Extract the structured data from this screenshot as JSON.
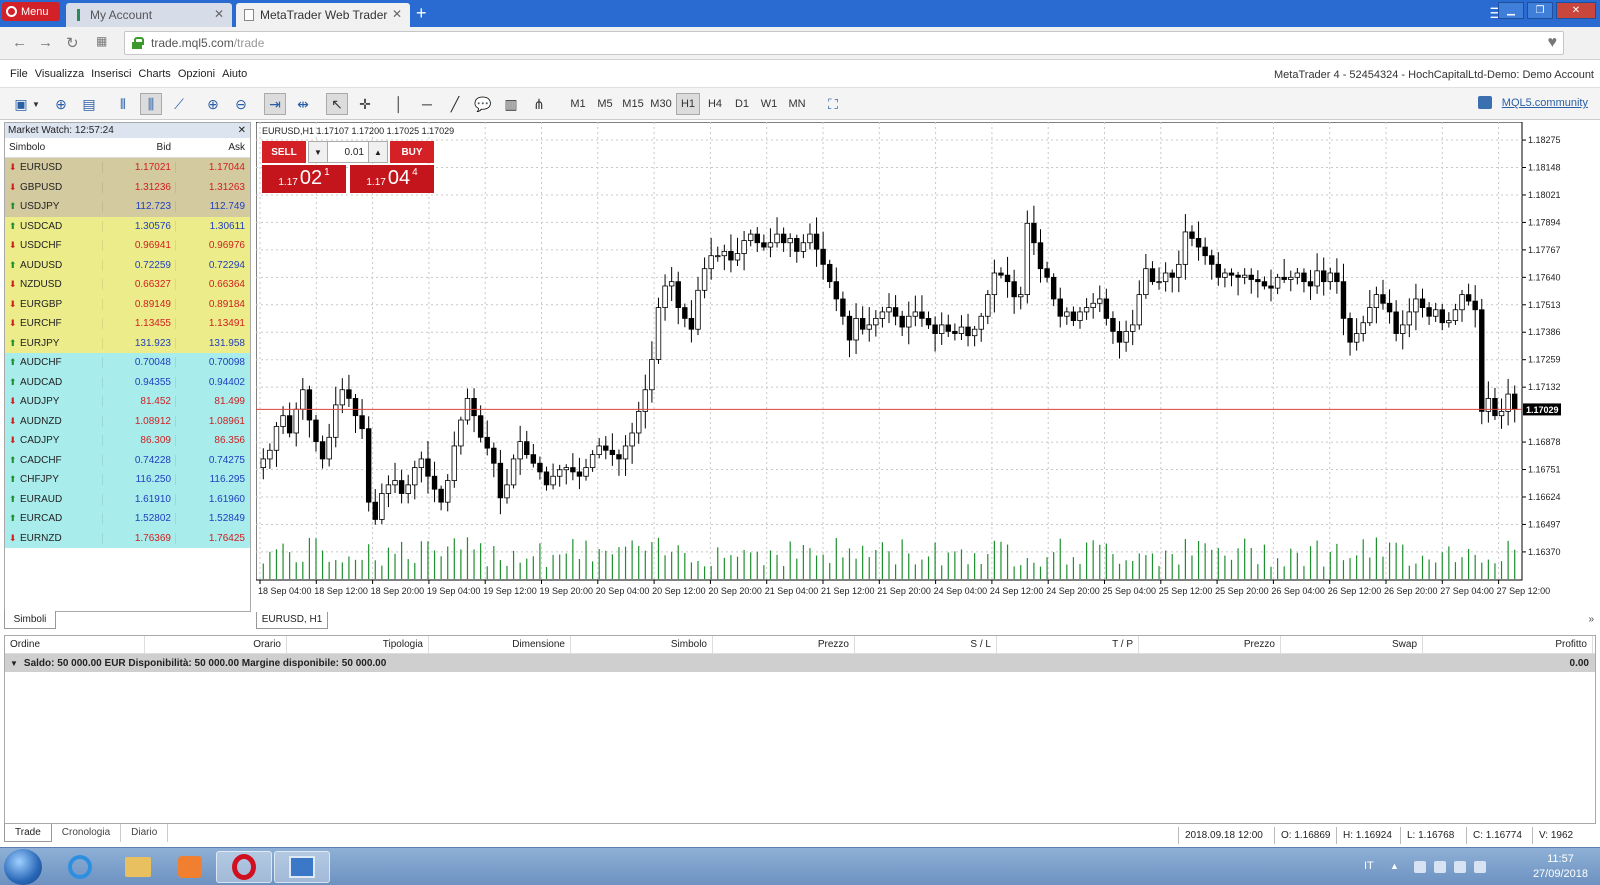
{
  "browser": {
    "menu_label": "Menu",
    "tabs": [
      {
        "title": "My Account",
        "active": false
      },
      {
        "title": "MetaTrader Web Trader",
        "active": true
      }
    ],
    "url_domain": "trade.mql5.com",
    "url_path": "/trade"
  },
  "app_menu": [
    "File",
    "Visualizza",
    "Inserisci",
    "Charts",
    "Opzioni",
    "Aiuto"
  ],
  "account_label": "MetaTrader 4 - 52454324 - HochCapitalLtd-Demo: Demo Account",
  "toolbar": {
    "timeframes": [
      "M1",
      "M5",
      "M15",
      "M30",
      "H1",
      "H4",
      "D1",
      "W1",
      "MN"
    ],
    "selected_timeframe": "H1",
    "community_link": "MQL5.community"
  },
  "market_watch": {
    "title": "Market Watch: 12:57:24",
    "headers": {
      "symbol": "Simbolo",
      "bid": "Bid",
      "ask": "Ask"
    },
    "rows": [
      {
        "symbol": "EURUSD",
        "bid": "1.17021",
        "ask": "1.17044",
        "dir": "down",
        "bg": "#d4ca9f"
      },
      {
        "symbol": "GBPUSD",
        "bid": "1.31236",
        "ask": "1.31263",
        "dir": "down",
        "bg": "#d4ca9f"
      },
      {
        "symbol": "USDJPY",
        "bid": "112.723",
        "ask": "112.749",
        "dir": "up",
        "bg": "#d4ca9f"
      },
      {
        "symbol": "USDCAD",
        "bid": "1.30576",
        "ask": "1.30611",
        "dir": "up",
        "bg": "#ecec8a"
      },
      {
        "symbol": "USDCHF",
        "bid": "0.96941",
        "ask": "0.96976",
        "dir": "down",
        "bg": "#ecec8a"
      },
      {
        "symbol": "AUDUSD",
        "bid": "0.72259",
        "ask": "0.72294",
        "dir": "up",
        "bg": "#ecec8a"
      },
      {
        "symbol": "NZDUSD",
        "bid": "0.66327",
        "ask": "0.66364",
        "dir": "down",
        "bg": "#ecec8a"
      },
      {
        "symbol": "EURGBP",
        "bid": "0.89149",
        "ask": "0.89184",
        "dir": "down",
        "bg": "#ecec8a"
      },
      {
        "symbol": "EURCHF",
        "bid": "1.13455",
        "ask": "1.13491",
        "dir": "down",
        "bg": "#ecec8a"
      },
      {
        "symbol": "EURJPY",
        "bid": "131.923",
        "ask": "131.958",
        "dir": "up",
        "bg": "#ecec8a"
      },
      {
        "symbol": "AUDCHF",
        "bid": "0.70048",
        "ask": "0.70098",
        "dir": "up",
        "bg": "#a9ecec"
      },
      {
        "symbol": "AUDCAD",
        "bid": "0.94355",
        "ask": "0.94402",
        "dir": "up",
        "bg": "#a9ecec"
      },
      {
        "symbol": "AUDJPY",
        "bid": "81.452",
        "ask": "81.499",
        "dir": "down",
        "bg": "#a9ecec"
      },
      {
        "symbol": "AUDNZD",
        "bid": "1.08912",
        "ask": "1.08961",
        "dir": "down",
        "bg": "#a9ecec"
      },
      {
        "symbol": "CADJPY",
        "bid": "86.309",
        "ask": "86.356",
        "dir": "down",
        "bg": "#a9ecec"
      },
      {
        "symbol": "CADCHF",
        "bid": "0.74228",
        "ask": "0.74275",
        "dir": "up",
        "bg": "#a9ecec"
      },
      {
        "symbol": "CHFJPY",
        "bid": "116.250",
        "ask": "116.295",
        "dir": "up",
        "bg": "#a9ecec"
      },
      {
        "symbol": "EURAUD",
        "bid": "1.61910",
        "ask": "1.61960",
        "dir": "up",
        "bg": "#a9ecec"
      },
      {
        "symbol": "EURCAD",
        "bid": "1.52802",
        "ask": "1.52849",
        "dir": "up",
        "bg": "#a9ecec"
      },
      {
        "symbol": "EURNZD",
        "bid": "1.76369",
        "ask": "1.76425",
        "dir": "down",
        "bg": "#a9ecec"
      }
    ],
    "tab_label": "Simboli"
  },
  "one_click": {
    "sell_label": "SELL",
    "buy_label": "BUY",
    "lot": "0.01",
    "sell_small": "1.17",
    "sell_big": "02",
    "sell_tiny": "1",
    "buy_small": "1.17",
    "buy_big": "04",
    "buy_tiny": "4"
  },
  "chart_data": {
    "type": "candlestick",
    "info": "EURUSD,H1  1.17107 1.17200 1.17025 1.17029",
    "tab_label": "EURUSD, H1",
    "ylim": [
      1.1624,
      1.1834
    ],
    "y_ticks": [
      "1.18275",
      "1.18148",
      "1.18021",
      "1.17894",
      "1.17767",
      "1.17640",
      "1.17513",
      "1.17386",
      "1.17259",
      "1.17132",
      "1.16878",
      "1.16751",
      "1.16624",
      "1.16497",
      "1.16370"
    ],
    "current_price": "1.17029",
    "x_labels": [
      "18 Sep 04:00",
      "18 Sep 12:00",
      "18 Sep 20:00",
      "19 Sep 04:00",
      "19 Sep 12:00",
      "19 Sep 20:00",
      "20 Sep 04:00",
      "20 Sep 12:00",
      "20 Sep 20:00",
      "21 Sep 04:00",
      "21 Sep 12:00",
      "21 Sep 20:00",
      "24 Sep 04:00",
      "24 Sep 12:00",
      "24 Sep 20:00",
      "25 Sep 04:00",
      "25 Sep 12:00",
      "25 Sep 20:00",
      "26 Sep 04:00",
      "26 Sep 12:00",
      "26 Sep 20:00",
      "27 Sep 04:00",
      "27 Sep 12:00"
    ],
    "close": [
      1.168,
      1.1684,
      1.1695,
      1.17,
      1.1692,
      1.1703,
      1.1712,
      1.1698,
      1.1688,
      1.168,
      1.169,
      1.1705,
      1.1712,
      1.1708,
      1.17,
      1.1694,
      1.166,
      1.1652,
      1.1664,
      1.1668,
      1.167,
      1.1664,
      1.1668,
      1.1676,
      1.168,
      1.1672,
      1.1666,
      1.166,
      1.167,
      1.1686,
      1.1698,
      1.1708,
      1.17,
      1.169,
      1.1685,
      1.1678,
      1.1662,
      1.1668,
      1.168,
      1.1688,
      1.1682,
      1.1678,
      1.1674,
      1.1668,
      1.1672,
      1.1675,
      1.1676,
      1.1674,
      1.1672,
      1.1676,
      1.1682,
      1.1686,
      1.1684,
      1.1682,
      1.168,
      1.1686,
      1.1692,
      1.1702,
      1.1712,
      1.1726,
      1.175,
      1.176,
      1.1762,
      1.175,
      1.1745,
      1.174,
      1.1758,
      1.1768,
      1.1774,
      1.1774,
      1.1776,
      1.1772,
      1.1775,
      1.1781,
      1.1784,
      1.178,
      1.1778,
      1.178,
      1.1784,
      1.178,
      1.1782,
      1.1776,
      1.178,
      1.1784,
      1.1777,
      1.177,
      1.1762,
      1.1754,
      1.1746,
      1.1735,
      1.1745,
      1.174,
      1.1742,
      1.1745,
      1.1748,
      1.175,
      1.1746,
      1.1741,
      1.1746,
      1.1748,
      1.1745,
      1.1742,
      1.1738,
      1.1742,
      1.1739,
      1.1738,
      1.1741,
      1.1737,
      1.174,
      1.1746,
      1.1756,
      1.1766,
      1.1765,
      1.1762,
      1.1755,
      1.1756,
      1.1789,
      1.178,
      1.1768,
      1.1764,
      1.1754,
      1.1746,
      1.1748,
      1.1744,
      1.1748,
      1.175,
      1.1752,
      1.1754,
      1.1745,
      1.1739,
      1.1734,
      1.1739,
      1.1742,
      1.1756,
      1.1768,
      1.1762,
      1.1762,
      1.1766,
      1.1764,
      1.177,
      1.1785,
      1.1782,
      1.1778,
      1.1774,
      1.177,
      1.1764,
      1.1766,
      1.1765,
      1.1764,
      1.1765,
      1.1763,
      1.1762,
      1.176,
      1.1759,
      1.1764,
      1.1763,
      1.1764,
      1.1766,
      1.1762,
      1.176,
      1.1767,
      1.1762,
      1.1766,
      1.1762,
      1.1745,
      1.1734,
      1.1738,
      1.1743,
      1.175,
      1.1756,
      1.1752,
      1.1748,
      1.1738,
      1.1742,
      1.1748,
      1.1754,
      1.175,
      1.1746,
      1.1749,
      1.1743,
      1.1744,
      1.1749,
      1.1756,
      1.1753,
      1.1749,
      1.1702,
      1.1708,
      1.17,
      1.1702,
      1.171,
      1.1703
    ]
  },
  "terminal": {
    "headers": [
      "Ordine",
      "Orario",
      "Tipologia",
      "Dimensione",
      "Simbolo",
      "Prezzo",
      "S / L",
      "T / P",
      "Prezzo",
      "Swap",
      "Profitto"
    ],
    "saldo_text": "Saldo: 50 000.00 EUR  Disponibilità: 50 000.00  Margine disponibile: 50 000.00",
    "saldo_total": "0.00",
    "tabs": [
      "Trade",
      "Cronologia",
      "Diario"
    ]
  },
  "status": {
    "datetime": "2018.09.18 12:00",
    "open": "O: 1.16869",
    "high": "H: 1.16924",
    "low": "L: 1.16768",
    "close": "C: 1.16774",
    "volume": "V: 1962"
  },
  "taskbar": {
    "lang": "IT",
    "time": "11:57",
    "date": "27/09/2018"
  },
  "colors": {
    "sell_buy": "#d42126",
    "volume": "#1e8f2e",
    "current_price_line": "#e04040"
  }
}
